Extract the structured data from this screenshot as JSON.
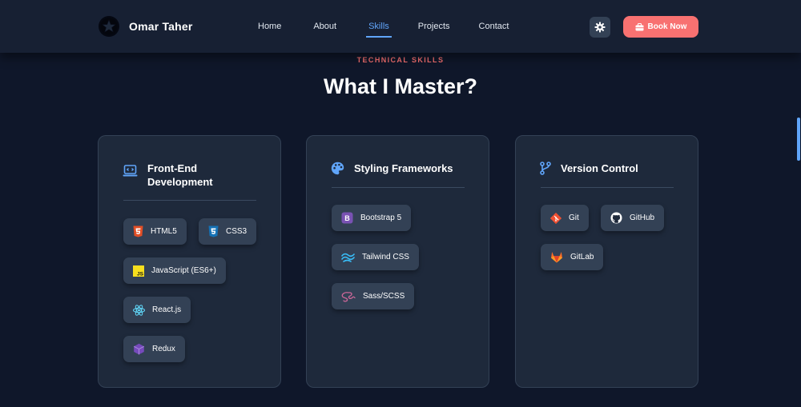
{
  "nav": {
    "brand": "Omar Taher",
    "links": [
      "Home",
      "About",
      "Skills",
      "Projects",
      "Contact"
    ],
    "active_link": "Skills",
    "book_label": "Book Now"
  },
  "section": {
    "eyebrow": "TECHNICAL SKILLS",
    "title": "What I Master?"
  },
  "cards": [
    {
      "title": "Front-End Development",
      "icon": "laptop-code-icon",
      "skills": [
        {
          "label": "HTML5",
          "icon": "html5-icon"
        },
        {
          "label": "CSS3",
          "icon": "css3-icon"
        },
        {
          "label": "JavaScript (ES6+)",
          "icon": "javascript-icon"
        },
        {
          "label": "React.js",
          "icon": "react-icon"
        },
        {
          "label": "Redux",
          "icon": "redux-icon"
        }
      ]
    },
    {
      "title": "Styling Frameworks",
      "icon": "palette-icon",
      "skills": [
        {
          "label": "Bootstrap 5",
          "icon": "bootstrap-icon"
        },
        {
          "label": "Tailwind CSS",
          "icon": "tailwind-icon"
        },
        {
          "label": "Sass/SCSS",
          "icon": "sass-icon"
        }
      ]
    },
    {
      "title": "Version Control",
      "icon": "code-branch-icon",
      "skills": [
        {
          "label": "Git",
          "icon": "git-icon"
        },
        {
          "label": "GitHub",
          "icon": "github-icon"
        },
        {
          "label": "GitLab",
          "icon": "gitlab-icon"
        }
      ]
    }
  ],
  "colors": {
    "accent": "#f87171",
    "link_active": "#60a5fa",
    "background": "#0f172a",
    "card": "#1e293b",
    "chip": "#334155"
  }
}
